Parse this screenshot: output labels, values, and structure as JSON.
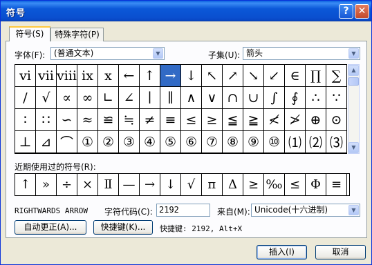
{
  "title": "符号",
  "titlebar_buttons": {
    "help": "?",
    "close": "✕"
  },
  "tabs": [
    {
      "label": "符号(S)"
    },
    {
      "label": "特殊字符(P)"
    }
  ],
  "font": {
    "label": "字体(F):",
    "value": "(普通文本)"
  },
  "subset": {
    "label": "子集(U):",
    "value": "箭头"
  },
  "symbols": [
    "ⅵ",
    "ⅶ",
    "ⅷ",
    "ⅸ",
    "ⅹ",
    "←",
    "↑",
    "→",
    "↓",
    "↖",
    "↗",
    "↘",
    "↙",
    "∈",
    "∏",
    "∑",
    "∕",
    "√",
    "∝",
    "∞",
    "∟",
    "∠",
    "∣",
    "∥",
    "∧",
    "∨",
    "∩",
    "∪",
    "∫",
    "∮",
    "∴",
    "∵",
    "∶",
    "∷",
    "∽",
    "≈",
    "≌",
    "≒",
    "≠",
    "≡",
    "≤",
    "≥",
    "≦",
    "≧",
    "≮",
    "≯",
    "⊕",
    "⊙",
    "⊥",
    "⊿",
    "⌒",
    "①",
    "②",
    "③",
    "④",
    "⑤",
    "⑥",
    "⑦",
    "⑧",
    "⑨",
    "⑩",
    "⑴",
    "⑵",
    "⑶"
  ],
  "selected_index": 7,
  "recent": {
    "label": "近期使用过的符号(R):",
    "items": [
      "↑",
      "»",
      "÷",
      "×",
      "Ⅱ",
      "—",
      "→",
      "↓",
      "√",
      "п",
      "Δ",
      "≥",
      "‰",
      "≤",
      "Φ",
      "≡"
    ]
  },
  "char_name": "RIGHTWARDS ARROW",
  "code": {
    "label": "字符代码(C):",
    "value": "2192"
  },
  "from": {
    "label": "来自(M):",
    "value": "Unicode(十六进制)"
  },
  "buttons": {
    "autocorrect": "自动更正(A)...",
    "shortcut": "快捷键(K)...",
    "shortcut_text": "快捷键: 2192, Alt+X",
    "insert": "插入(I)",
    "cancel": "取消"
  },
  "colors": {
    "selection": "#316ac5",
    "title_blue": "#0a5fde"
  }
}
